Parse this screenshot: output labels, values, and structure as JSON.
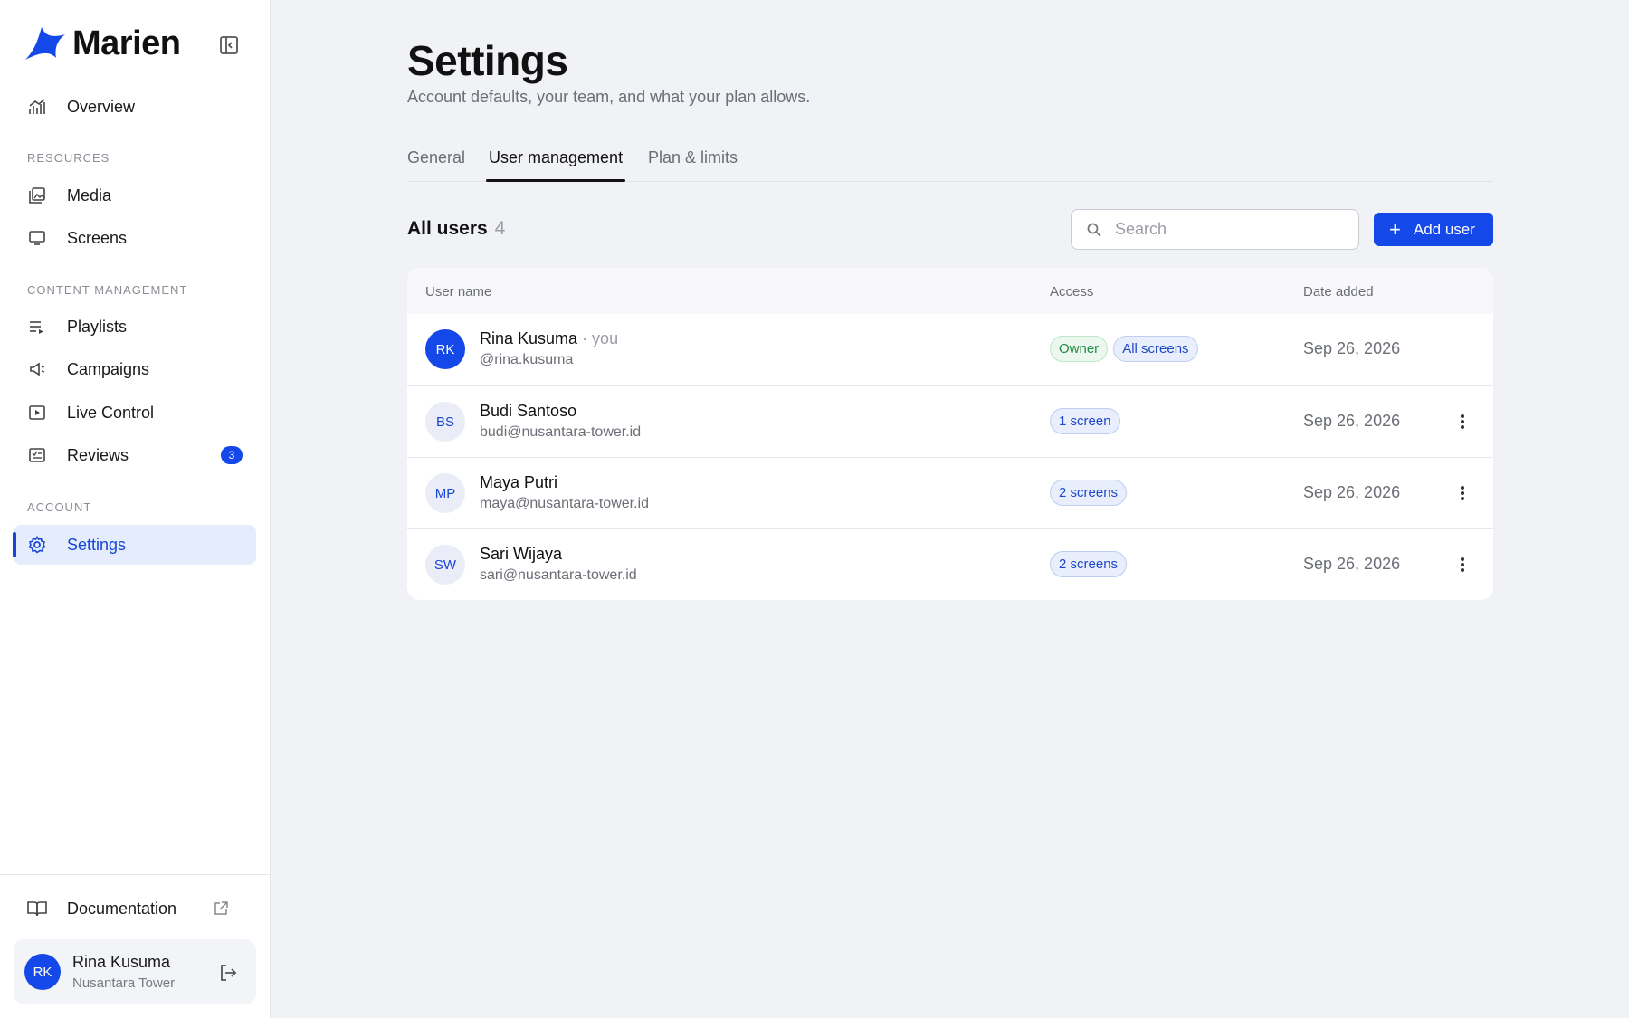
{
  "brand": {
    "name": "Marien",
    "accent": "#1448e8"
  },
  "sidebar": {
    "overview": "Overview",
    "sections": {
      "resources": "RESOURCES",
      "content": "CONTENT MANAGEMENT",
      "account": "ACCOUNT"
    },
    "items": {
      "media": "Media",
      "screens": "Screens",
      "playlists": "Playlists",
      "campaigns": "Campaigns",
      "live_control": "Live Control",
      "reviews": "Reviews",
      "reviews_badge": "3",
      "settings": "Settings"
    },
    "documentation": "Documentation",
    "user": {
      "initials": "RK",
      "name": "Rina Kusuma",
      "org": "Nusantara Tower"
    }
  },
  "page": {
    "title": "Settings",
    "subtitle": "Account defaults, your team, and what your plan allows."
  },
  "tabs": {
    "general": "General",
    "user_management": "User management",
    "plan": "Plan & limits",
    "active": "User management"
  },
  "users_section": {
    "title": "All users",
    "count": "4",
    "search_placeholder": "Search",
    "add_button": "Add user"
  },
  "table": {
    "headers": {
      "name": "User name",
      "access": "Access",
      "date": "Date added"
    },
    "rows": [
      {
        "initials": "RK",
        "name": "Rina Kusuma",
        "you": " · you",
        "email": "@rina.kusuma",
        "pills": [
          "Owner",
          "All screens"
        ],
        "date": "Sep 26, 2026"
      },
      {
        "initials": "BS",
        "name": "Budi Santoso",
        "email": "budi@nusantara-tower.id",
        "pills": [
          "1 screen"
        ],
        "date": "Sep 26, 2026"
      },
      {
        "initials": "MP",
        "name": "Maya Putri",
        "email": "maya@nusantara-tower.id",
        "pills": [
          "2 screens"
        ],
        "date": "Sep 26, 2026"
      },
      {
        "initials": "SW",
        "name": "Sari Wijaya",
        "email": "sari@nusantara-tower.id",
        "pills": [
          "2 screens"
        ],
        "date": "Sep 26, 2026"
      }
    ]
  }
}
